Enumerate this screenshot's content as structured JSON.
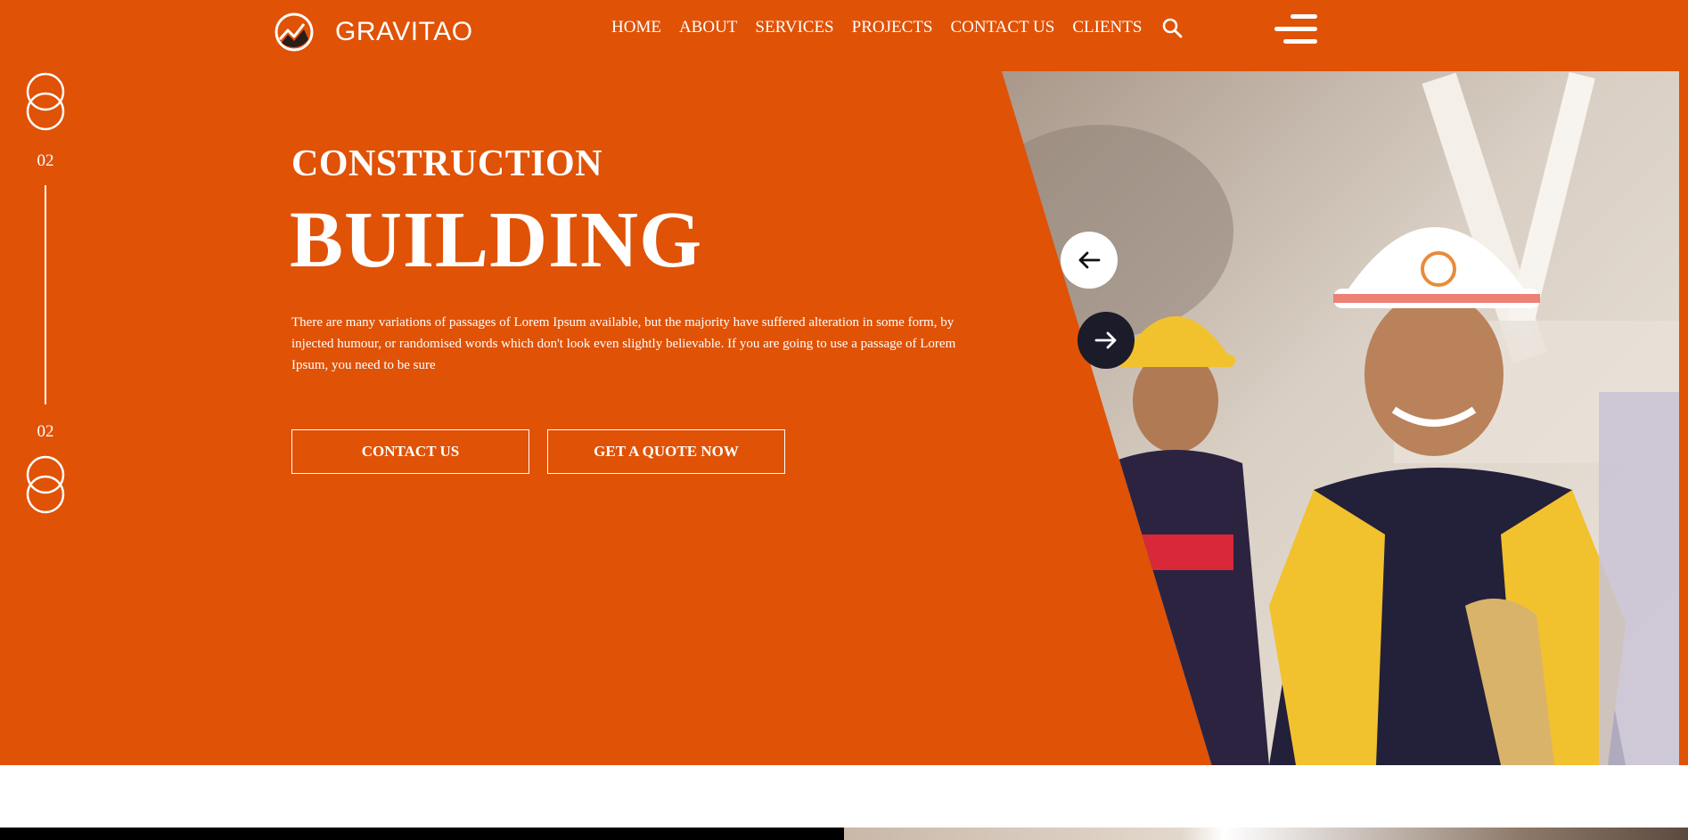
{
  "brand": {
    "name": "GRAVITAO",
    "logo_icon": "mountain-chart-icon"
  },
  "nav": {
    "items": [
      "HOME",
      "ABOUT",
      "SERVICES",
      "PROJECTS",
      "CONTACT US",
      "CLIENTS"
    ],
    "search_icon": "search-icon",
    "menu_icon": "hamburger-menu-icon"
  },
  "slider": {
    "current": "02",
    "total": "02"
  },
  "hero": {
    "eyebrow": "CONSTRUCTION",
    "headline": "BUILDING",
    "description": "There are many variations of passages of Lorem Ipsum available, but the majority have suffered alteration in some form, by injected humour, or randomised words which don't look even slightly believable. If you are going to use a passage of Lorem Ipsum, you need to be sure",
    "buttons": {
      "contact": "CONTACT US",
      "quote": "GET A QUOTE NOW"
    }
  },
  "colors": {
    "accent": "#e05206",
    "dark": "#1b1b2a",
    "text": "#ffffff"
  }
}
